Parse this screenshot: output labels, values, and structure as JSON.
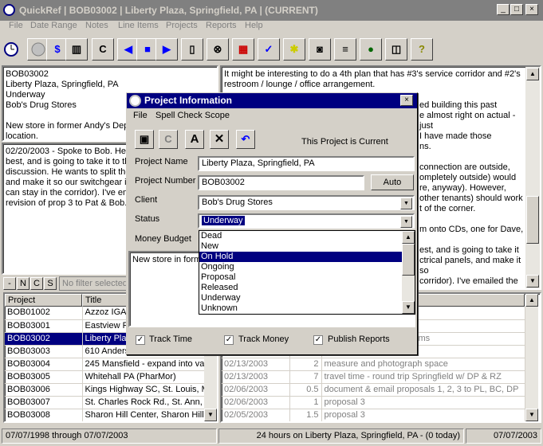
{
  "window": {
    "title": "QuickRef | BOB03002 | Liberty Plaza, Springfield, PA | (CURRENT)",
    "minimize": "_",
    "maximize": "□",
    "close": "×"
  },
  "menu": [
    "File",
    "Date Range",
    "Notes",
    "Line Items",
    "Projects",
    "Reports",
    "Help"
  ],
  "toolbar": {
    "c_label": "C"
  },
  "summary": {
    "lines": [
      "BOB03002",
      "Liberty Plaza, Springfield, PA",
      "Underway",
      "Bob's Drug Stores",
      "",
      "New store in former Andy's Depa",
      "location."
    ]
  },
  "notes_left": {
    "lines": [
      "02/20/2003 - Spoke to Bob. He",
      "best, and is going to take it to th",
      "discussion. He wants to split the",
      "and make it so our switchgear is",
      "can stay in the corridor). I've em",
      "revision of prop 3 to Pat & Bob."
    ]
  },
  "notes_right": {
    "lines": [
      "It might be interesting to do a 4th plan that has #3's service corridor and #2's",
      "restroom / lounge / office arrangement.",
      "",
      "ed building this past",
      "e almost right on actual - just",
      "I have made those",
      "ns.",
      "",
      "connection are outside,",
      "ompletely outside) would",
      "re, anyway). However,",
      "other tenants) should work",
      "t of the corner.",
      "",
      "m onto CDs, one for Dave,",
      "",
      "est, and is going to take it",
      "ctrical panels, and make it so",
      "corridor). I've emailed the"
    ]
  },
  "filter": {
    "buttons": [
      "-",
      "N",
      "C",
      "S"
    ],
    "placeholder": "No filter selected"
  },
  "projects": {
    "headers": [
      "Project",
      "Title"
    ],
    "rows": [
      [
        "BOB01002",
        "Azzoz IGA"
      ],
      [
        "BOB03001",
        "Eastview F"
      ],
      [
        "BOB03002",
        "Liberty Pla"
      ],
      [
        "BOB03003",
        "610 Anders"
      ],
      [
        "BOB03004",
        "245 Mansfield - expand into vac"
      ],
      [
        "BOB03005",
        "Whitehall PA (PharMor)"
      ],
      [
        "BOB03006",
        "Kings Highway SC, St. Louis, M"
      ],
      [
        "BOB03007",
        "St. Charles Rock Rd., St. Ann,"
      ],
      [
        "BOB03008",
        "Sharon Hill Center, Sharon Hill,"
      ]
    ],
    "selected": 2
  },
  "lineitems": {
    "rows": [
      [
        "",
        "",
        "ail latest revision"
      ],
      [
        "",
        "",
        "CD-ROMs for DP & BC"
      ],
      [
        "",
        "",
        "all 3 proposals to field dims"
      ],
      [
        "",
        "",
        ""
      ],
      [
        "02/13/2003",
        "2",
        "measure and photograph space"
      ],
      [
        "02/13/2003",
        "7",
        "travel time - round trip Springfield w/ DP & RZ"
      ],
      [
        "02/06/2003",
        "0.5",
        "document & email proposals 1, 2, 3 to PL, BC, DP"
      ],
      [
        "02/06/2003",
        "1",
        "proposal 3"
      ],
      [
        "02/05/2003",
        "1.5",
        "proposal 3"
      ]
    ]
  },
  "status": {
    "range": "07/07/1998 through 07/07/2003",
    "hours": "24 hours on Liberty Plaza, Springfield, PA - (0 today)",
    "date": "07/07/2003"
  },
  "dialog": {
    "title": "Project Information",
    "menu": [
      "File",
      "Spell Check Scope"
    ],
    "current_text": "This Project is Current",
    "name_label": "Project Name",
    "name_value": "Liberty Plaza, Springfield, PA",
    "number_label": "Project Number",
    "number_value": "BOB03002",
    "auto_label": "Auto",
    "client_label": "Client",
    "client_value": "Bob's Drug Stores",
    "status_label": "Status",
    "status_value": "Underway",
    "budget_label": "Money Budget",
    "notes_value": "New store in former",
    "status_options": [
      "Dead",
      "New",
      "On Hold",
      "Ongoing",
      "Proposal",
      "Released",
      "Underway",
      "Unknown"
    ],
    "status_highlight": 2,
    "track_time": "Track Time",
    "track_money": "Track Money",
    "publish_reports": "Publish Reports",
    "close": "×",
    "a_label": "A",
    "c_label": "C"
  },
  "colors": {
    "accent": "#000080",
    "chrome": "#d4d0c8"
  }
}
